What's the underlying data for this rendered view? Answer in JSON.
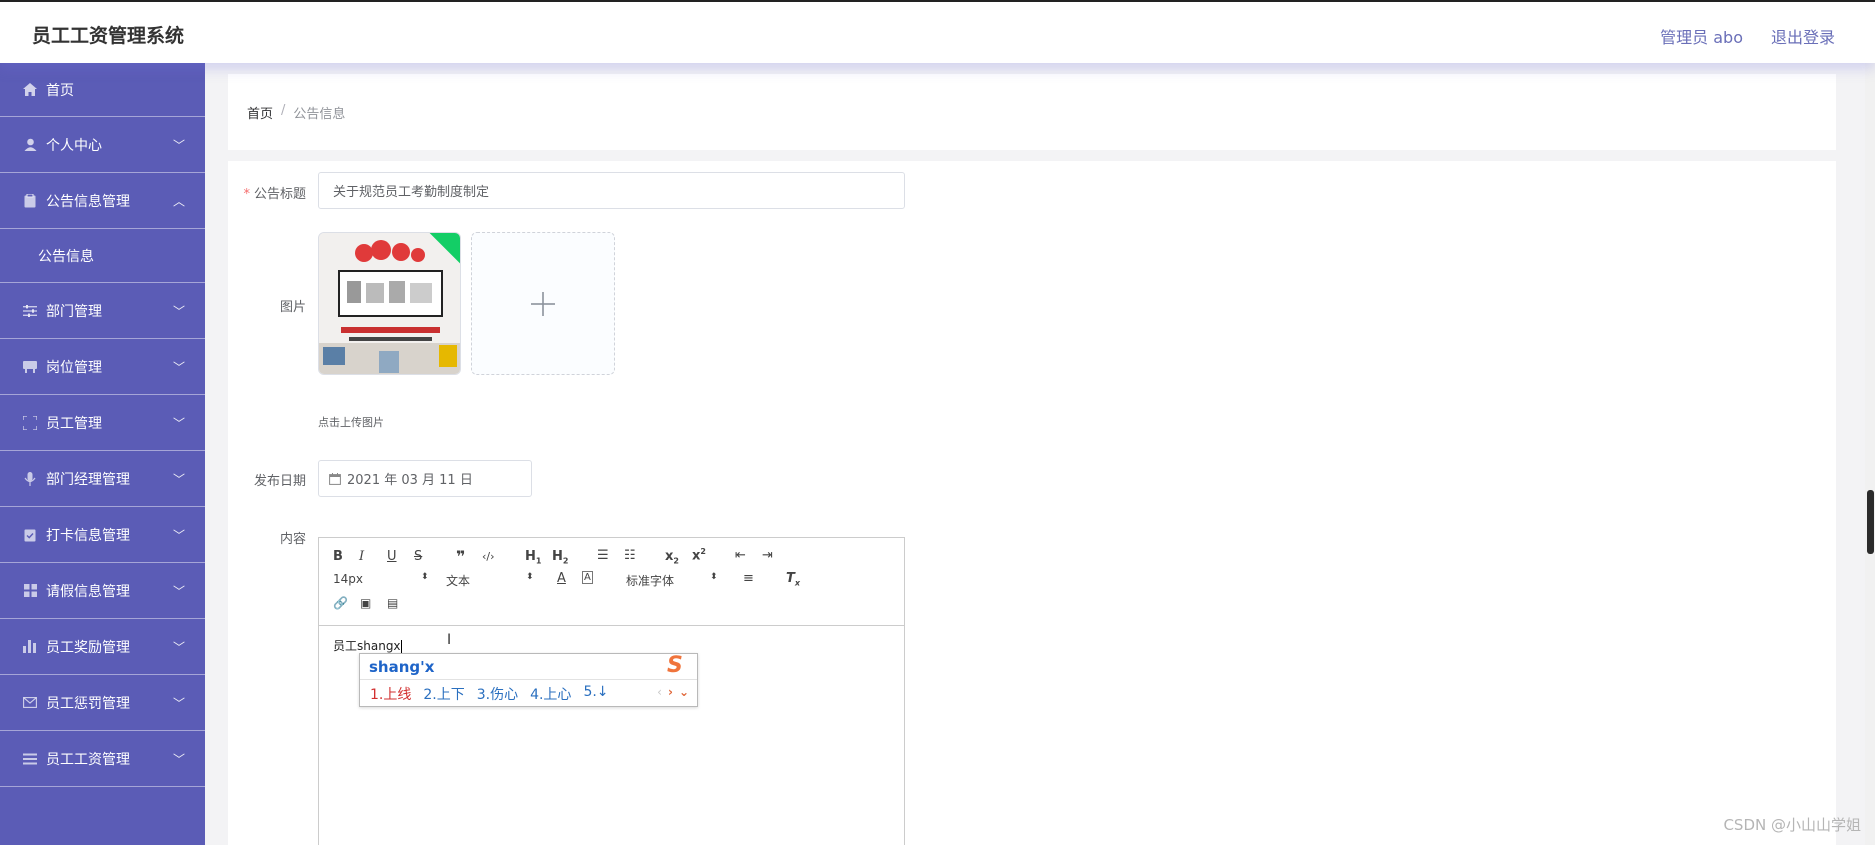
{
  "header": {
    "app_title": "员工工资管理系统",
    "user_label": "管理员 abo",
    "logout_label": "退出登录"
  },
  "sidebar": {
    "items": [
      {
        "label": "首页",
        "icon": "home-icon"
      },
      {
        "label": "个人中心",
        "icon": "user-icon"
      },
      {
        "label": "公告信息管理",
        "icon": "notice-icon"
      },
      {
        "label": "公告信息",
        "icon": ""
      },
      {
        "label": "部门管理",
        "icon": "sliders-icon"
      },
      {
        "label": "岗位管理",
        "icon": "desk-icon"
      },
      {
        "label": "员工管理",
        "icon": "frame-icon"
      },
      {
        "label": "部门经理管理",
        "icon": "mic-icon"
      },
      {
        "label": "打卡信息管理",
        "icon": "clipboard-icon"
      },
      {
        "label": "请假信息管理",
        "icon": "grid-icon"
      },
      {
        "label": "员工奖励管理",
        "icon": "bar-chart-icon"
      },
      {
        "label": "员工惩罚管理",
        "icon": "mail-icon"
      },
      {
        "label": "员工工资管理",
        "icon": "list-icon"
      }
    ]
  },
  "breadcrumb": {
    "home": "首页",
    "separator": "/",
    "current": "公告信息"
  },
  "form": {
    "title_label": "公告标题",
    "title_value": "关于规范员工考勤制度制定",
    "image_label": "图片",
    "upload_hint": "点击上传图片",
    "date_label": "发布日期",
    "date_value": "2021 年 03 月 11 日",
    "content_label": "内容"
  },
  "editor": {
    "font_size": "14px",
    "text_type": "文本",
    "font_family": "标准字体",
    "content": "员工shangx"
  },
  "ime": {
    "input": "shang'x",
    "candidates": [
      "1.上线",
      "2.上下",
      "3.伤心",
      "4.上心",
      "5.↓"
    ]
  },
  "watermark": "CSDN @小山山学姐",
  "colors": {
    "sidebar": "#5b5cb6",
    "accent": "#6a6fb8",
    "success": "#13ce66"
  }
}
